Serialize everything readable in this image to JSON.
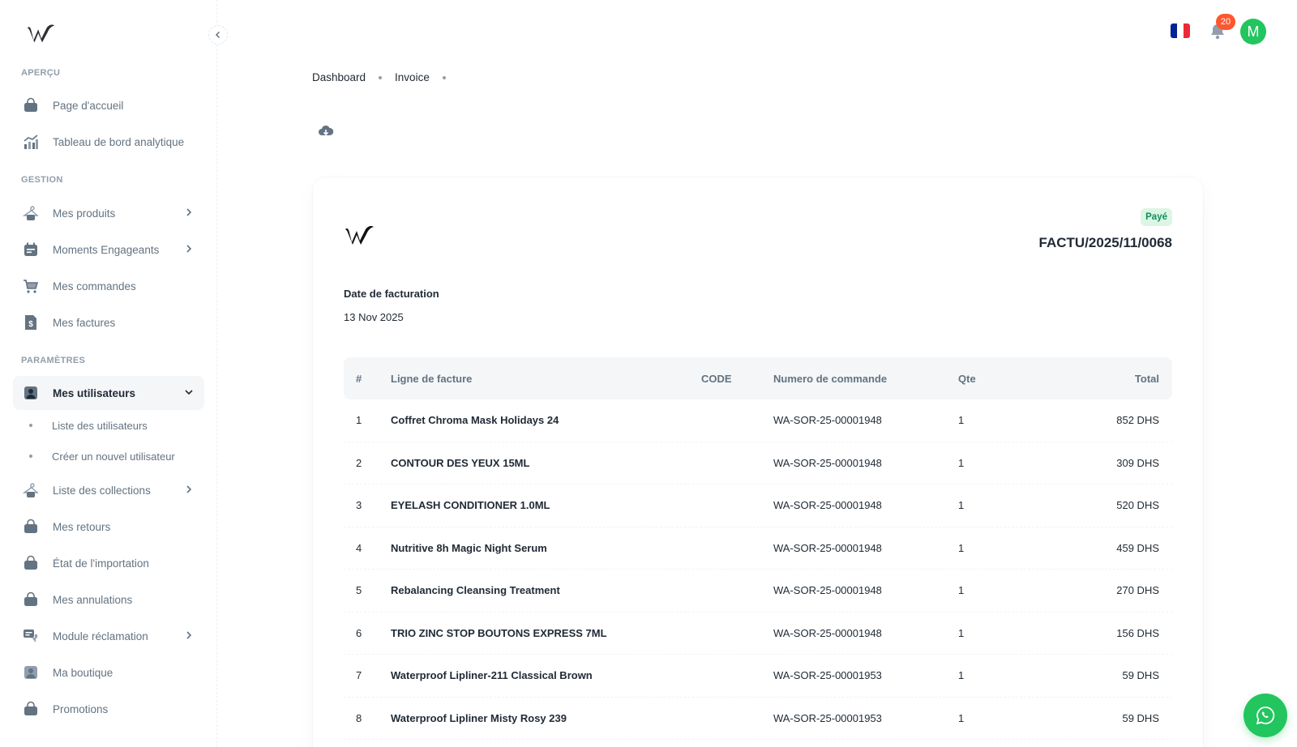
{
  "sidebar": {
    "sections": [
      {
        "title": "APERÇU"
      },
      {
        "title": "GESTION"
      },
      {
        "title": "PARAMÈTRES"
      }
    ],
    "items": [
      {
        "label": "Page d'accueil",
        "icon": "bag-icon"
      },
      {
        "label": "Tableau de bord analytique",
        "icon": "analytics-icon"
      },
      {
        "label": "Mes produits",
        "icon": "hanger-icon"
      },
      {
        "label": "Moments Engageants",
        "icon": "calendar-icon"
      },
      {
        "label": "Mes commandes",
        "icon": "cart-icon"
      },
      {
        "label": "Mes factures",
        "icon": "invoice-icon"
      },
      {
        "label": "Mes utilisateurs",
        "icon": "user-icon"
      },
      {
        "label": "Liste des collections",
        "icon": "hanger-icon"
      },
      {
        "label": "Mes retours",
        "icon": "bag-icon"
      },
      {
        "label": "État de l'importation",
        "icon": "bag-icon"
      },
      {
        "label": "Mes annulations",
        "icon": "bag-icon"
      },
      {
        "label": "Module réclamation",
        "icon": "chat-icon"
      },
      {
        "label": "Ma boutique",
        "icon": "user-icon"
      },
      {
        "label": "Promotions",
        "icon": "bag-icon"
      }
    ],
    "sub_items": [
      {
        "label": "Liste des utilisateurs"
      },
      {
        "label": "Créer un nouvel utilisateur"
      }
    ]
  },
  "header": {
    "notification_count": "20",
    "avatar_initial": "M",
    "flag_colors": [
      "#002395",
      "#ffffff",
      "#ed2939"
    ]
  },
  "breadcrumb": [
    "Dashboard",
    "Invoice"
  ],
  "invoice": {
    "status": "Payé",
    "number": "FACTU/2025/11/0068",
    "date_label": "Date de facturation",
    "date_value": "13 Nov 2025",
    "columns": [
      "#",
      "Ligne de facture",
      "CODE",
      "Numero de commande",
      "Qte",
      "Total"
    ],
    "rows": [
      {
        "num": "1",
        "line": "Coffret Chroma Mask Holidays 24",
        "code": "",
        "order": "WA-SOR-25-00001948",
        "qty": "1",
        "total": "852 DHS"
      },
      {
        "num": "2",
        "line": "CONTOUR DES YEUX 15ML",
        "code": "",
        "order": "WA-SOR-25-00001948",
        "qty": "1",
        "total": "309 DHS"
      },
      {
        "num": "3",
        "line": "EYELASH CONDITIONER 1.0ML",
        "code": "",
        "order": "WA-SOR-25-00001948",
        "qty": "1",
        "total": "520 DHS"
      },
      {
        "num": "4",
        "line": "Nutritive 8h Magic Night Serum",
        "code": "",
        "order": "WA-SOR-25-00001948",
        "qty": "1",
        "total": "459 DHS"
      },
      {
        "num": "5",
        "line": "Rebalancing Cleansing Treatment",
        "code": "",
        "order": "WA-SOR-25-00001948",
        "qty": "1",
        "total": "270 DHS"
      },
      {
        "num": "6",
        "line": "TRIO ZINC STOP BOUTONS EXPRESS 7ML",
        "code": "",
        "order": "WA-SOR-25-00001948",
        "qty": "1",
        "total": "156 DHS"
      },
      {
        "num": "7",
        "line": "Waterproof Lipliner-211 Classical Brown",
        "code": "",
        "order": "WA-SOR-25-00001953",
        "qty": "1",
        "total": "59 DHS"
      },
      {
        "num": "8",
        "line": "Waterproof Lipliner Misty Rosy 239",
        "code": "",
        "order": "WA-SOR-25-00001953",
        "qty": "1",
        "total": "59 DHS"
      }
    ]
  },
  "colors": {
    "accent_green": "#22c55e",
    "badge_red": "#ff5630",
    "paid_text": "#118d57"
  }
}
